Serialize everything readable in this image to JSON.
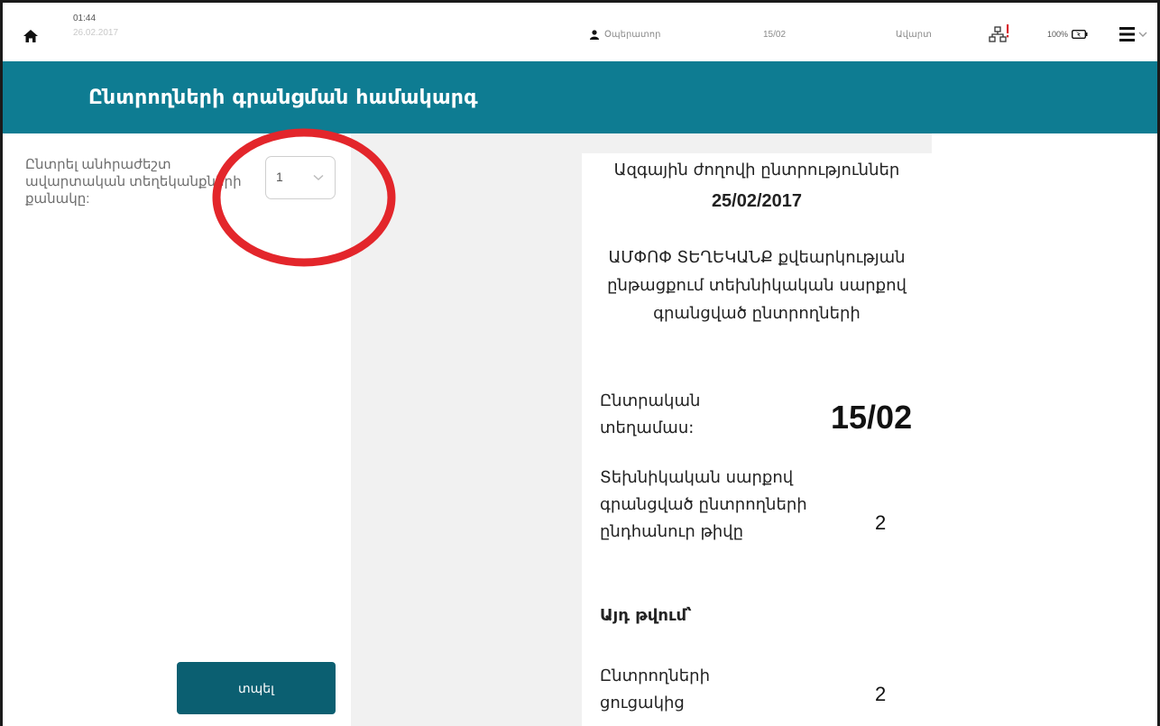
{
  "status_bar": {
    "time": "01:44",
    "date": "26.02.2017",
    "operator": "Օպերատոր",
    "station": "15/02",
    "end_label": "Ավարտ",
    "battery": "100%"
  },
  "app": {
    "title": "Ընտրողների գրանցման համակարգ"
  },
  "left_panel": {
    "prompt": "Ընտրել անհրաժեշտ ավարտական տեղեկանքների քանակը:",
    "copies_select_value": "1",
    "print_button": "տպել"
  },
  "report": {
    "election_title": "Ազգային ժողովի ընտրություններ",
    "election_date": "25/02/2017",
    "summary_title": "ԱՄՓՈՓ ՏԵՂԵԿԱՆՔ քվեարկության ընթացքում տեխնիկական սարքով գրանցված ընտրողների",
    "station_label": "Ընտրական տեղամաս:",
    "station_value": "15/02",
    "total_label": "Տեխնիկական սարքով գրանցված ընտրողների ընդհանուր թիվը",
    "total_value": "2",
    "including_label": "Այդ թվում՝",
    "from_list_label": "Ընտրողների ցուցակից",
    "from_list_value": "2"
  },
  "colors": {
    "header": "#0e7c92",
    "button": "#0b5f71",
    "annotation": "#e3262b",
    "alert": "#d9262b"
  },
  "icons": {
    "home": "home-icon",
    "user": "user-icon",
    "network": "network-icon",
    "battery": "battery-icon",
    "menu": "hamburger-menu-icon",
    "dropdown": "chevron-down-icon"
  }
}
